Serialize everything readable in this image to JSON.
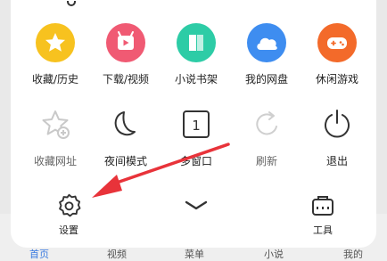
{
  "row1": [
    {
      "label": "收藏/历史",
      "icon": "star-icon",
      "color": "#f7c21f"
    },
    {
      "label": "下载/视频",
      "icon": "download-video-icon",
      "color": "#f05a73"
    },
    {
      "label": "小说书架",
      "icon": "book-icon",
      "color": "#2dcca6"
    },
    {
      "label": "我的网盘",
      "icon": "cloud-icon",
      "color": "#3e8df0"
    },
    {
      "label": "休闲游戏",
      "icon": "gamepad-icon",
      "color": "#f36a2a"
    }
  ],
  "row2": [
    {
      "label": "收藏网址",
      "icon": "star-plus-icon"
    },
    {
      "label": "夜间模式",
      "icon": "moon-icon"
    },
    {
      "label": "多窗口",
      "icon": "window-count-icon",
      "count": "1"
    },
    {
      "label": "刷新",
      "icon": "refresh-icon"
    },
    {
      "label": "退出",
      "icon": "power-icon"
    }
  ],
  "row3": {
    "settings": {
      "label": "设置",
      "icon": "gear-icon"
    },
    "collapse": {
      "icon": "chevron-down-icon"
    },
    "tools": {
      "label": "工具",
      "icon": "toolbox-icon"
    }
  },
  "bottom_nav": [
    {
      "label": "首页",
      "active": true
    },
    {
      "label": "视频",
      "active": false
    },
    {
      "label": "菜单",
      "active": false
    },
    {
      "label": "小说",
      "active": false
    },
    {
      "label": "我的",
      "active": false
    }
  ],
  "annotation": {
    "color": "#e8333a"
  }
}
